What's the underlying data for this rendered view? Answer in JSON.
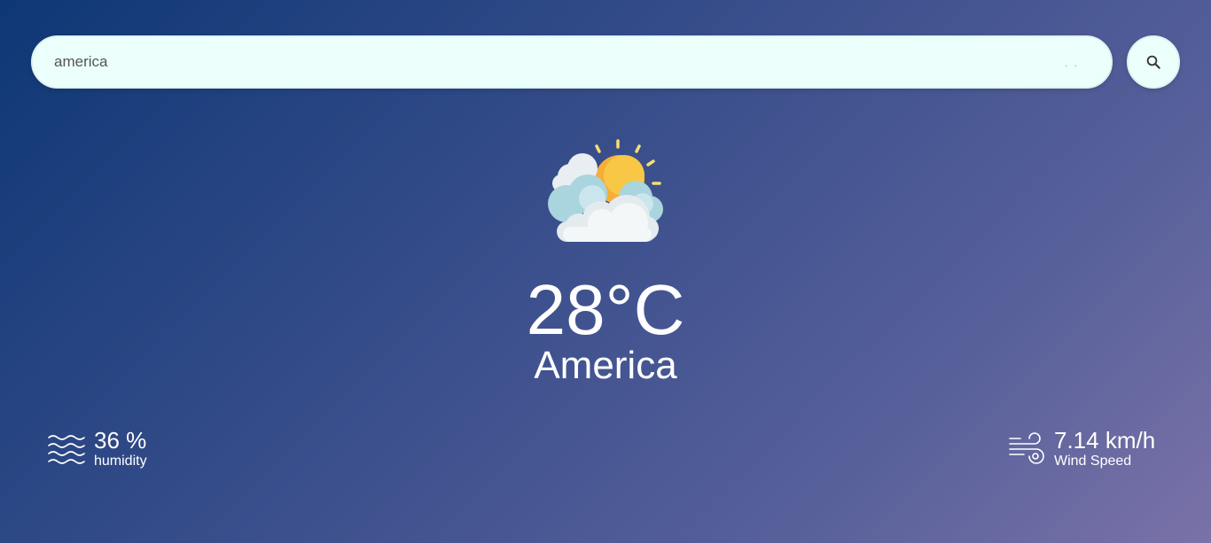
{
  "search": {
    "value": "america",
    "dots": ". ."
  },
  "weather": {
    "icon": "partly-cloudy-sun-icon",
    "temperature": "28°C",
    "city": "America"
  },
  "humidity": {
    "icon": "humidity-waves-icon",
    "value": "36 %",
    "label": "humidity"
  },
  "wind": {
    "icon": "wind-icon",
    "value": "7.14 km/h",
    "label": "Wind Speed"
  },
  "colors": {
    "background_start": "#0e3775",
    "background_end": "#7a72a8",
    "search_bg": "#ebfffb",
    "sun": "#f9c440",
    "cloud": "#eef3f5",
    "text": "#ffffff"
  }
}
